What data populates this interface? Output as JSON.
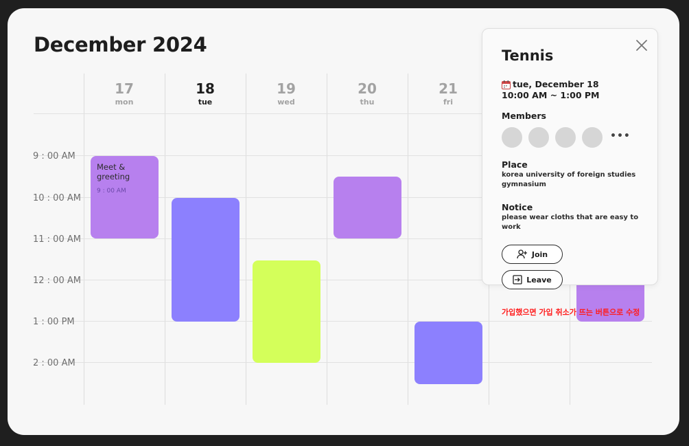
{
  "calendar": {
    "month_title": "December 2024",
    "days": [
      {
        "num": "17",
        "name": "mon",
        "active": false
      },
      {
        "num": "18",
        "name": "tue",
        "active": true
      },
      {
        "num": "19",
        "name": "wed",
        "active": false
      },
      {
        "num": "20",
        "name": "thu",
        "active": false
      },
      {
        "num": "21",
        "name": "fri",
        "active": false
      }
    ],
    "times": [
      "9 : 00 AM",
      "10 : 00 AM",
      "11 : 00 AM",
      "12 : 00 AM",
      "1 : 00 PM",
      "2 : 00 AM"
    ],
    "events": [
      {
        "day": "mon",
        "title": "Meet & greeting",
        "time": "9 : 00 AM",
        "color": "#b780ee"
      },
      {
        "day": "tue",
        "title": "",
        "time": "",
        "color": "#8c80fe"
      },
      {
        "day": "wed",
        "title": "",
        "time": "",
        "color": "#d4ff5a"
      },
      {
        "day": "thu",
        "title": "",
        "time": "",
        "color": "#b780ee"
      },
      {
        "day": "fri",
        "title": "",
        "time": "",
        "color": "#8c80fe"
      },
      {
        "day": "",
        "title": "",
        "time": "",
        "color": "#b780ee"
      }
    ]
  },
  "popup": {
    "title": "Tennis",
    "date_icon": "calendar-icon",
    "date": "tue, December 18",
    "time_range": "10:00 AM ~ 1:00 PM",
    "members_label": "Members",
    "members_more": "•••",
    "place_label": "Place",
    "place_text": "korea university of foreign studies gymnasium",
    "notice_label": "Notice",
    "notice_text": "please wear cloths that are easy to work",
    "join_label": "Join",
    "leave_label": "Leave",
    "close_icon": "close-icon"
  },
  "annotation": {
    "note_text": "가입했으면 가입 취소가 뜨는 버튼으로 수정",
    "note_color": "#ff1c1c"
  }
}
